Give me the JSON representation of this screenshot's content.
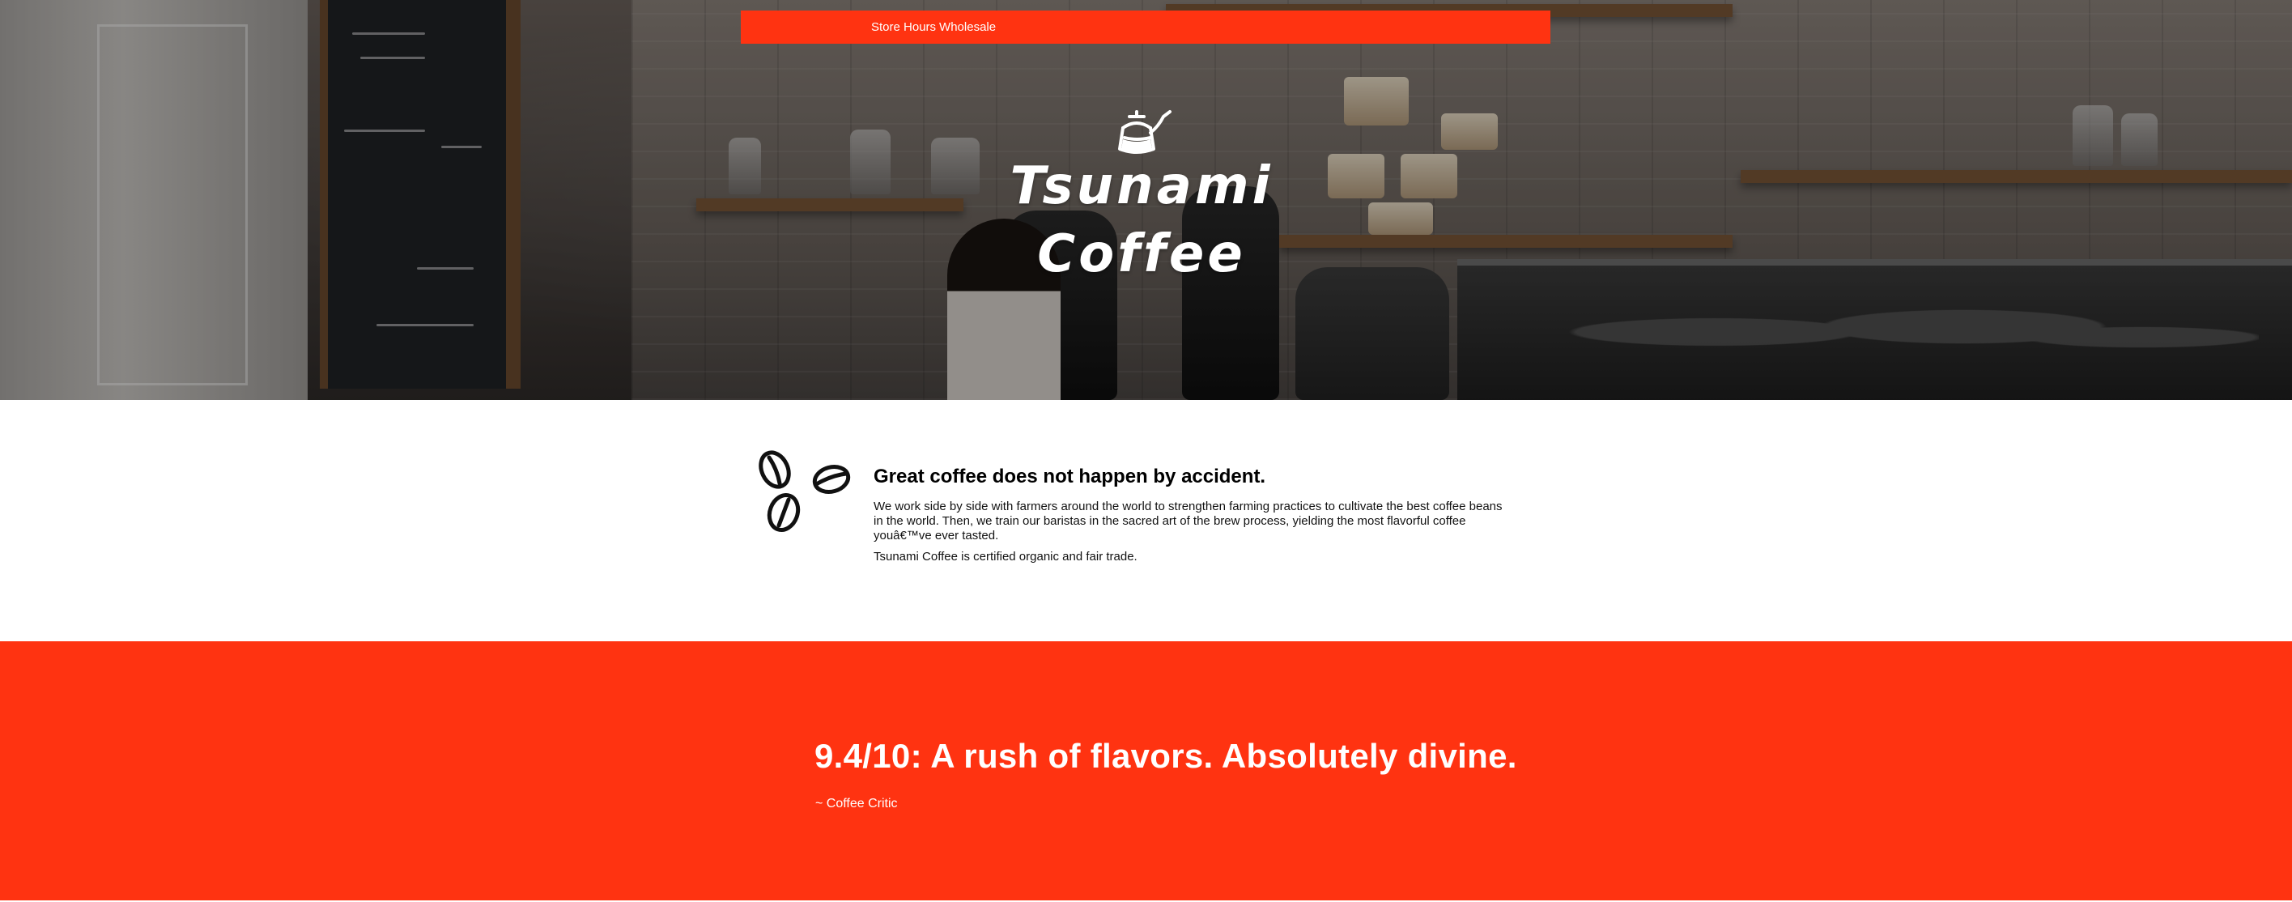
{
  "nav": {
    "links": [
      "Store Hours",
      "Wholesale"
    ]
  },
  "hero": {
    "logo_icon": "pour-over-kettle-icon",
    "logo_line1": "Tsunami",
    "logo_line2": "Coffee"
  },
  "about": {
    "icon": "coffee-beans-icon",
    "heading": "Great coffee does not happen by accident.",
    "paragraph1": "We work side by side with farmers around the world to strengthen farming practices to cultivate the best coffee beans in the world. Then, we train our baristas in the sacred art of the brew process, yielding the most flavorful coffee youâ€™ve ever tasted.",
    "paragraph2": "Tsunami Coffee is certified organic and fair trade."
  },
  "review": {
    "quote": "9.4/10: A rush of flavors. Absolutely divine.",
    "author": "~ Coffee Critic"
  },
  "colors": {
    "accent": "#ff3311",
    "text_on_accent": "#ffffff",
    "body_text": "#111111"
  }
}
